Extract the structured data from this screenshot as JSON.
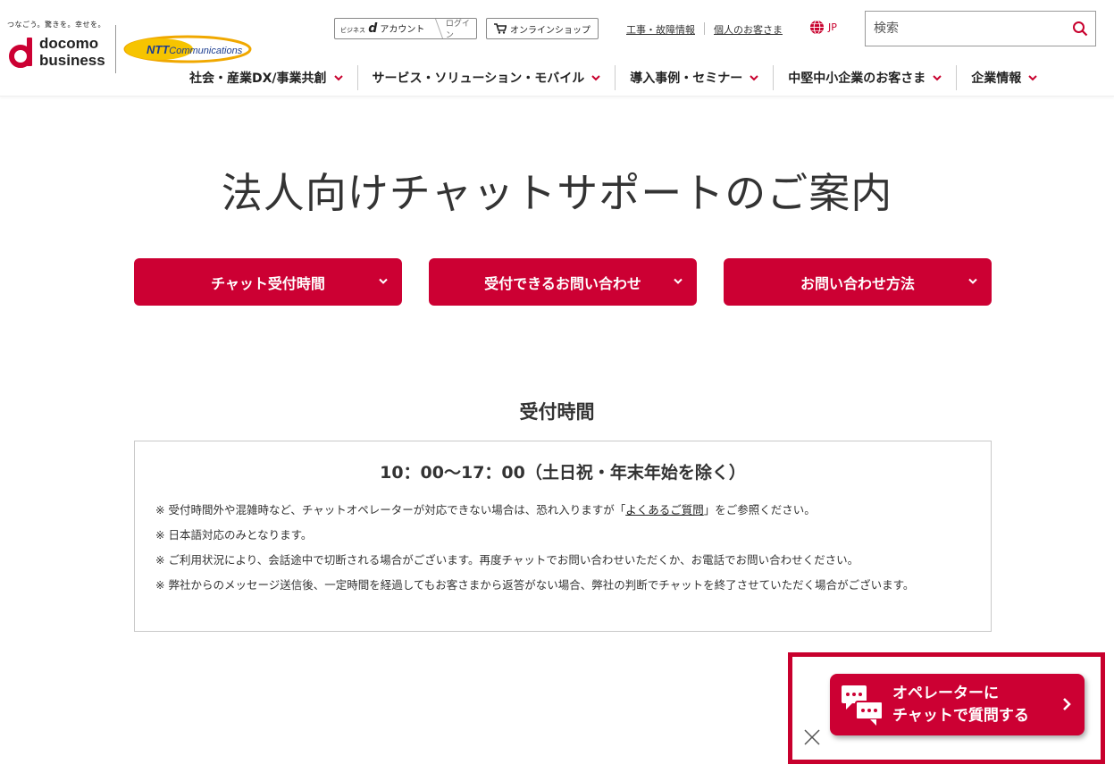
{
  "header": {
    "tagline": "つなごう。驚きを。幸せを。",
    "brand_docomo_1": "docomo",
    "brand_docomo_2": "business",
    "brand_ntt_a": "NTT",
    "brand_ntt_b": "Communications",
    "account_small": "ビジネス",
    "account_d": "d",
    "account_label": "アカウント",
    "login_label": "ログイン",
    "shop_label": "オンラインショップ",
    "link_outage": "工事・故障情報",
    "link_personal": "個人のお客さま",
    "lang": "JP",
    "search_placeholder": "検索"
  },
  "nav": [
    {
      "label": "社会・産業DX/事業共創"
    },
    {
      "label": "サービス・ソリューション・モバイル"
    },
    {
      "label": "導入事例・セミナー"
    },
    {
      "label": "中堅中小企業のお客さま"
    },
    {
      "label": "企業情報"
    }
  ],
  "main": {
    "title": "法人向けチャットサポートのご案内",
    "tabs": [
      {
        "label": "チャット受付時間"
      },
      {
        "label": "受付できるお問い合わせ"
      },
      {
        "label": "お問い合わせ方法"
      }
    ],
    "section_heading": "受付時間",
    "hours": "10：00～17：00（土日祝・年末年始を除く）",
    "note1_pre": "※ 受付時間外や混雑時など、チャットオペレーターが対応できない場合は、恐れ入りますが「",
    "note1_link": "よくあるご質問",
    "note1_post": "」をご参照ください。",
    "note2": "※ 日本語対応のみとなります。",
    "note3": "※ ご利用状況により、会話途中で切断される場合がございます。再度チャットでお問い合わせいただくか、お電話でお問い合わせください。",
    "note4": "※ 弊社からのメッセージ送信後、一定時間を経過してもお客さまから返答がない場合、弊社の判断でチャットを終了させていただく場合がございます。"
  },
  "chat": {
    "line1": "オペレーターに",
    "line2": "チャットで質問する"
  },
  "colors": {
    "brand_red": "#cc0033",
    "ntt_blue": "#1c3d8f",
    "ntt_gold": "#f0a800"
  }
}
